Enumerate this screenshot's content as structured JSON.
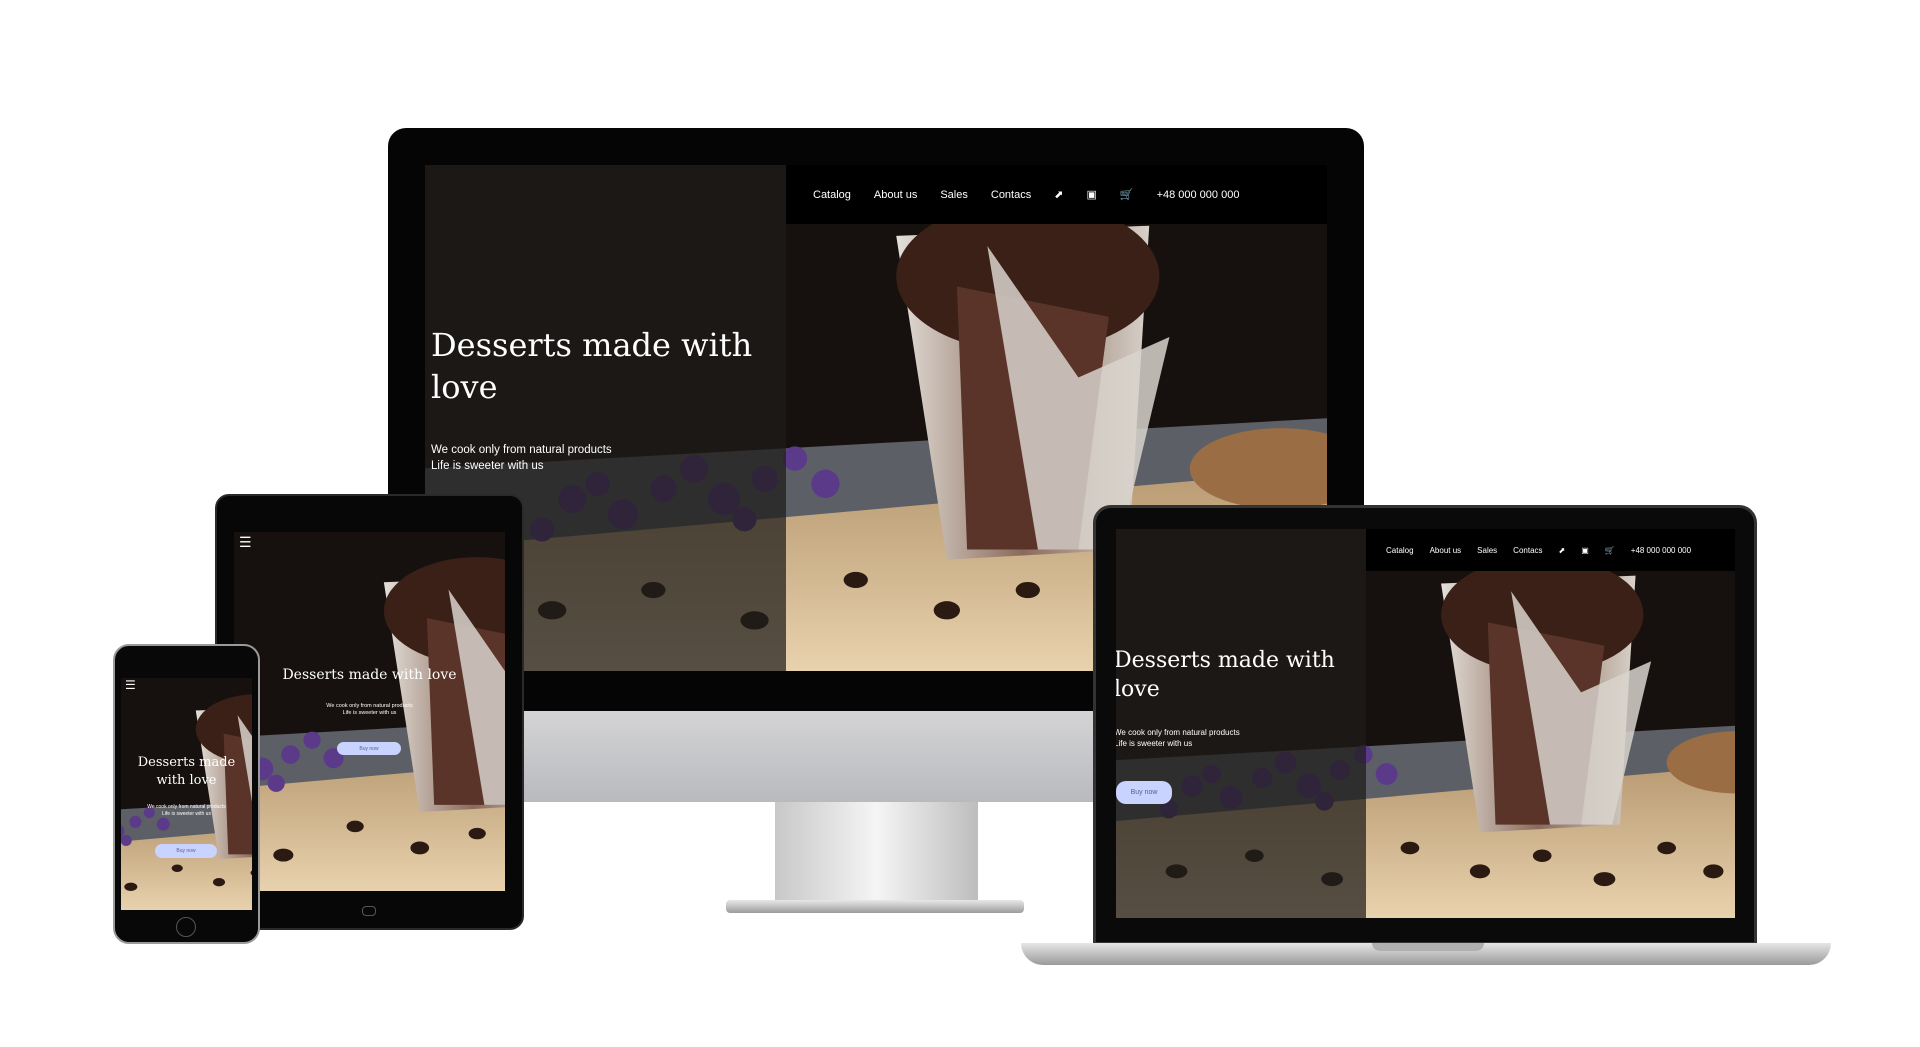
{
  "nav": {
    "items": [
      "Catalog",
      "About us",
      "Sales",
      "Contacs"
    ],
    "phone": "+48 000 000 000",
    "icons": [
      "cursor-icon",
      "instagram-icon",
      "cart-icon"
    ]
  },
  "hero": {
    "title": "Desserts made with love",
    "line1": "We cook only from natural products",
    "line2": "Life is sweeter with us",
    "button": "Buy now"
  },
  "colors": {
    "button": "#c9d3ff",
    "nav": "#000000"
  }
}
